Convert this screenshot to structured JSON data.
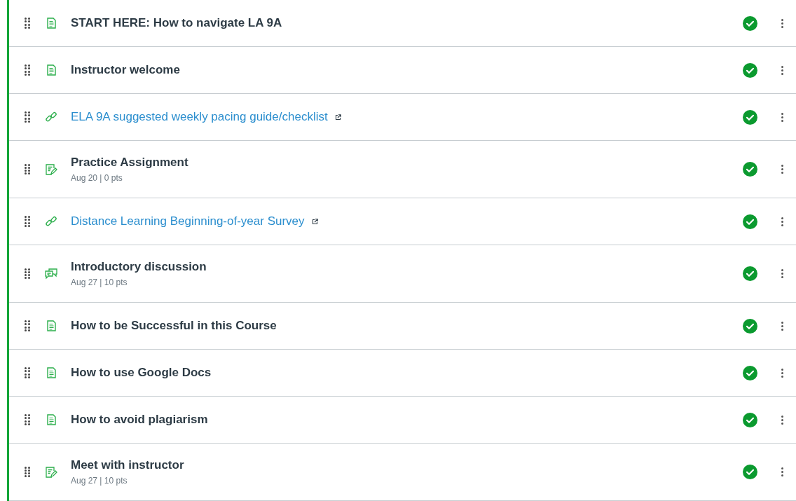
{
  "module_items": [
    {
      "kind": "page",
      "title": "START HERE: How to navigate LA 9A",
      "published": true
    },
    {
      "kind": "page",
      "title": "Instructor welcome",
      "published": true
    },
    {
      "kind": "link",
      "title": "ELA 9A suggested weekly pacing guide/checklist",
      "published": true
    },
    {
      "kind": "assignment",
      "title": "Practice Assignment",
      "details": "Aug 20 | 0 pts",
      "published": true
    },
    {
      "kind": "link",
      "title": "Distance Learning Beginning-of-year Survey",
      "published": true
    },
    {
      "kind": "discussion",
      "title": "Introductory discussion",
      "details": "Aug 27 | 10 pts",
      "published": true
    },
    {
      "kind": "page",
      "title": "How to be Successful in this Course",
      "published": true
    },
    {
      "kind": "page",
      "title": "How to use Google Docs",
      "published": true
    },
    {
      "kind": "page",
      "title": "How to avoid plagiarism",
      "published": true
    },
    {
      "kind": "assignment",
      "title": "Meet with instructor",
      "details": "Aug 27 | 10 pts",
      "published": true
    }
  ]
}
